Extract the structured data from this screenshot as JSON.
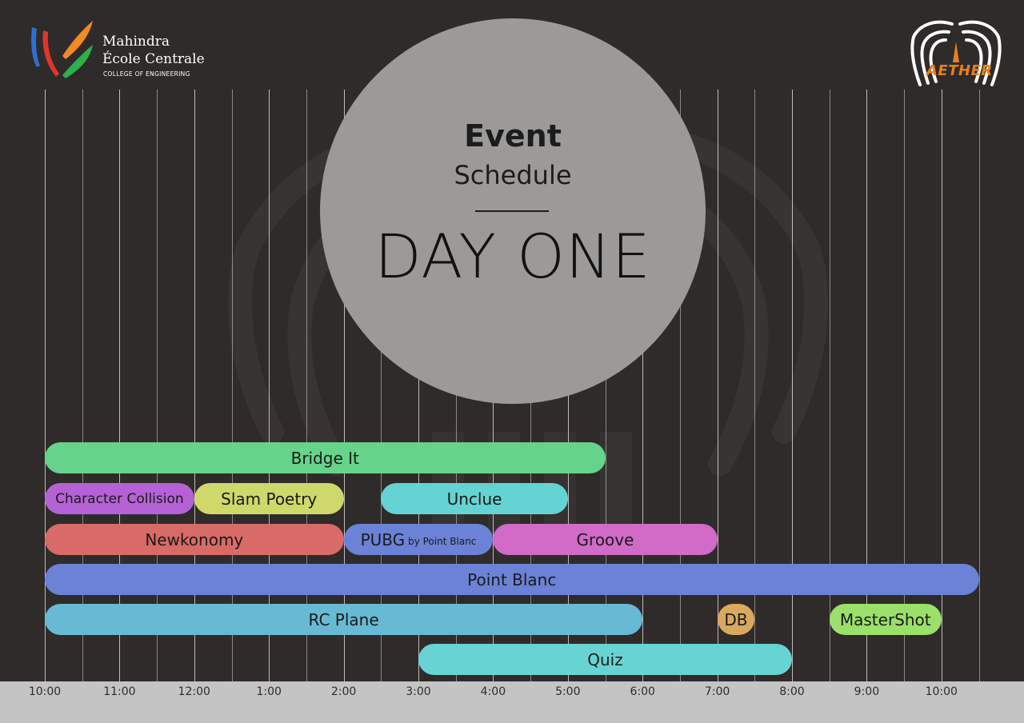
{
  "header": {
    "college_name_line1": "Mahindra",
    "college_name_line2": "École Centrale",
    "college_subtitle": "COLLEGE OF ENGINEERING",
    "fest_logo_text": "AETHER"
  },
  "title": {
    "event": "Event",
    "schedule": "Schedule",
    "day": "DAY ONE"
  },
  "timeline": {
    "tick_labels": [
      "10:00",
      "11:00",
      "12:00",
      "1:00",
      "2:00",
      "3:00",
      "4:00",
      "5:00",
      "6:00",
      "7:00",
      "8:00",
      "9:00",
      "10:00"
    ]
  },
  "events": [
    {
      "name": "Bridge It",
      "start": "10:00",
      "end": "17:30",
      "color": "#66d38b"
    },
    {
      "name": "Character Collision",
      "start": "10:00",
      "end": "12:00",
      "color": "#b462d6"
    },
    {
      "name": "Slam Poetry",
      "start": "12:00",
      "end": "14:00",
      "color": "#cfd86a"
    },
    {
      "name": "Unclue",
      "start": "14:30",
      "end": "17:00",
      "color": "#64d3d3"
    },
    {
      "name": "Newkonomy",
      "start": "10:00",
      "end": "14:00",
      "color": "#d86b67"
    },
    {
      "name": "PUBG",
      "suffix": "by Point Blanc",
      "start": "14:00",
      "end": "16:00",
      "color": "#6b82d6"
    },
    {
      "name": "Groove",
      "start": "16:00",
      "end": "19:00",
      "color": "#d26ac8"
    },
    {
      "name": "Point Blanc",
      "start": "10:00",
      "end": "22:30",
      "color": "#6b82d6"
    },
    {
      "name": "RC Plane",
      "start": "10:00",
      "end": "18:00",
      "color": "#68b9d4"
    },
    {
      "name": "DB",
      "start": "19:00",
      "end": "19:30",
      "color": "#d9a85f"
    },
    {
      "name": "MasterShot",
      "start": "20:30",
      "end": "22:00",
      "color": "#9be06a"
    },
    {
      "name": "Quiz",
      "start": "15:00",
      "end": "20:00",
      "color": "#68d3d3"
    }
  ],
  "colors": {
    "background": "#2e2b2a",
    "circle": "#9c9a98",
    "axis_bar": "#c4c4c4",
    "aether_orange": "#e8801c",
    "logo_blue": "#2f6fd0",
    "logo_red": "#e0352b",
    "logo_orange": "#f08a24",
    "logo_green": "#2fae4a"
  }
}
